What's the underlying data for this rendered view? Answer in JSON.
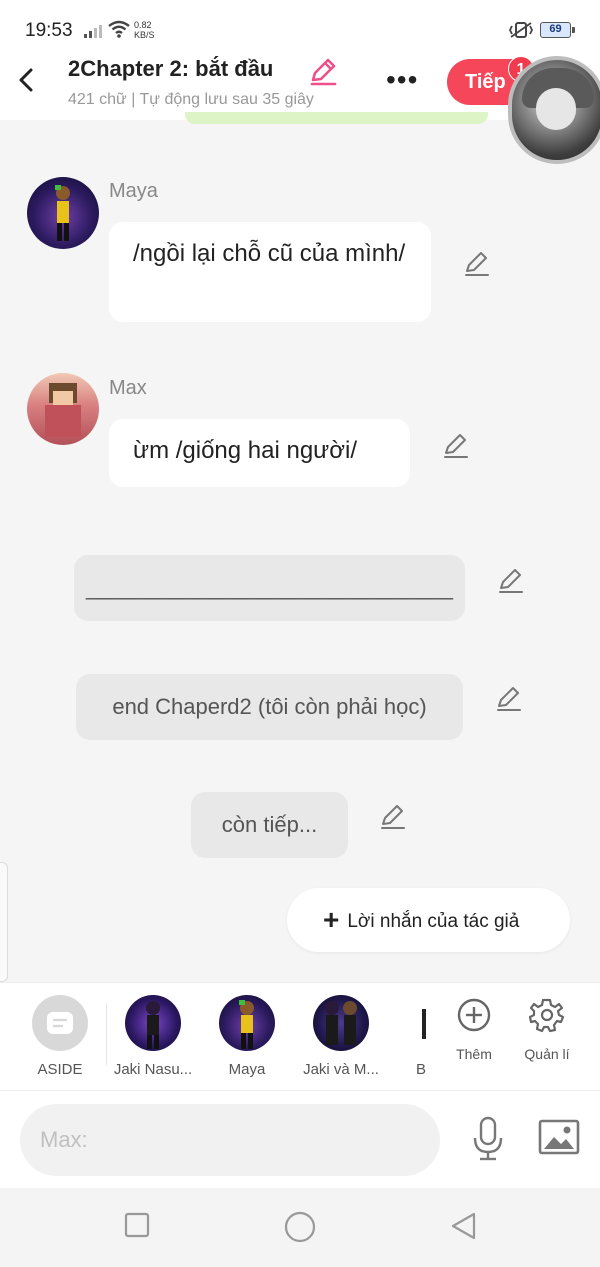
{
  "status_bar": {
    "time": "19:53",
    "speed_value": "0.82",
    "speed_unit": "KB/S",
    "battery": "69"
  },
  "header": {
    "title": "2Chapter 2: bắt đầu",
    "subtitle": "421 chữ | Tự động lưu sau 35 giây",
    "next_label": "Tiếp",
    "badge_count": "1"
  },
  "messages": [
    {
      "speaker": "Maya",
      "text": "/ngồi lại chỗ cũ của mình/"
    },
    {
      "speaker": "Max",
      "text": "ừm /giống hai người/"
    }
  ],
  "narrations": [
    {
      "text": "______________________________"
    },
    {
      "text": "end Chaperd2 (tôi còn phải học)"
    },
    {
      "text": "còn tiếp..."
    }
  ],
  "author_note_label": "Lời nhắn của tác giả",
  "character_bar": {
    "characters": [
      {
        "label": "ASIDE"
      },
      {
        "label": "Jaki Nasu..."
      },
      {
        "label": "Maya"
      },
      {
        "label": "Jaki và M..."
      },
      {
        "label": "B"
      }
    ],
    "tools": [
      {
        "label": "Thêm",
        "icon": "plus-circle-icon"
      },
      {
        "label": "Quản lí",
        "icon": "gear-icon"
      }
    ]
  },
  "input": {
    "placeholder": "Max:"
  },
  "colors": {
    "accent": "#f5465a",
    "pen_pink": "#f0508a"
  }
}
